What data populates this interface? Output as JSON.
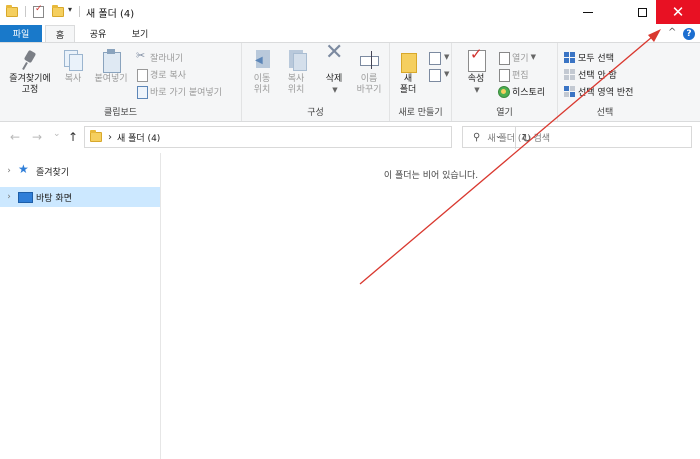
{
  "window": {
    "title": "새 폴더 (4)",
    "qa_dropdown": "▾",
    "minimize_glyph": "—",
    "maximize_glyph": "☐",
    "close_glyph": "✕"
  },
  "tabs": {
    "file": "파일",
    "home": "홈",
    "share": "공유",
    "view": "보기",
    "collapse_glyph": "^",
    "help_glyph": "?"
  },
  "ribbon": {
    "clipboard": {
      "pin_line1": "즐겨찾기에",
      "pin_line2": "고정",
      "copy": "복사",
      "paste": "붙여넣기",
      "cut": "잘라내기",
      "copy_path": "경로 복사",
      "paste_shortcut": "바로 가기 붙여넣기",
      "group_label": "클립보드"
    },
    "organize": {
      "move_to_line1": "이동",
      "move_to_line2": "위치",
      "copy_to_line1": "복사",
      "copy_to_line2": "위치",
      "delete": "삭제",
      "rename_line1": "이름",
      "rename_line2": "바꾸기",
      "group_label": "구성"
    },
    "new": {
      "new_folder_line1": "새",
      "new_folder_line2": "폴더",
      "group_label": "새로 만들기"
    },
    "open": {
      "properties": "속성",
      "open": "열기",
      "edit": "편집",
      "history": "히스토리",
      "group_label": "열기"
    },
    "select": {
      "select_all": "모두 선택",
      "select_none": "선택 안 함",
      "invert_selection": "선택 영역 반전",
      "group_label": "선택"
    }
  },
  "address": {
    "back_glyph": "←",
    "forward_glyph": "→",
    "recent_glyph": "⌄",
    "up_glyph": "↑",
    "crumb_sep": "›",
    "path": "새 폴더 (4)",
    "dropdown_glyph": "⌄",
    "refresh_glyph": "↻",
    "search_glyph": "⚲",
    "search_placeholder": "새 폴더 (4) 검색"
  },
  "nav_pane": {
    "expand_glyph": "›",
    "items": [
      {
        "label": "즐겨찾기"
      },
      {
        "label": "바탕 화면"
      }
    ]
  },
  "content": {
    "empty_message": "이 폴더는 비어 있습니다."
  },
  "colors": {
    "accent": "#1979ca",
    "close_red": "#e81123",
    "selection": "#cce8ff",
    "annotation": "#d9382f"
  }
}
